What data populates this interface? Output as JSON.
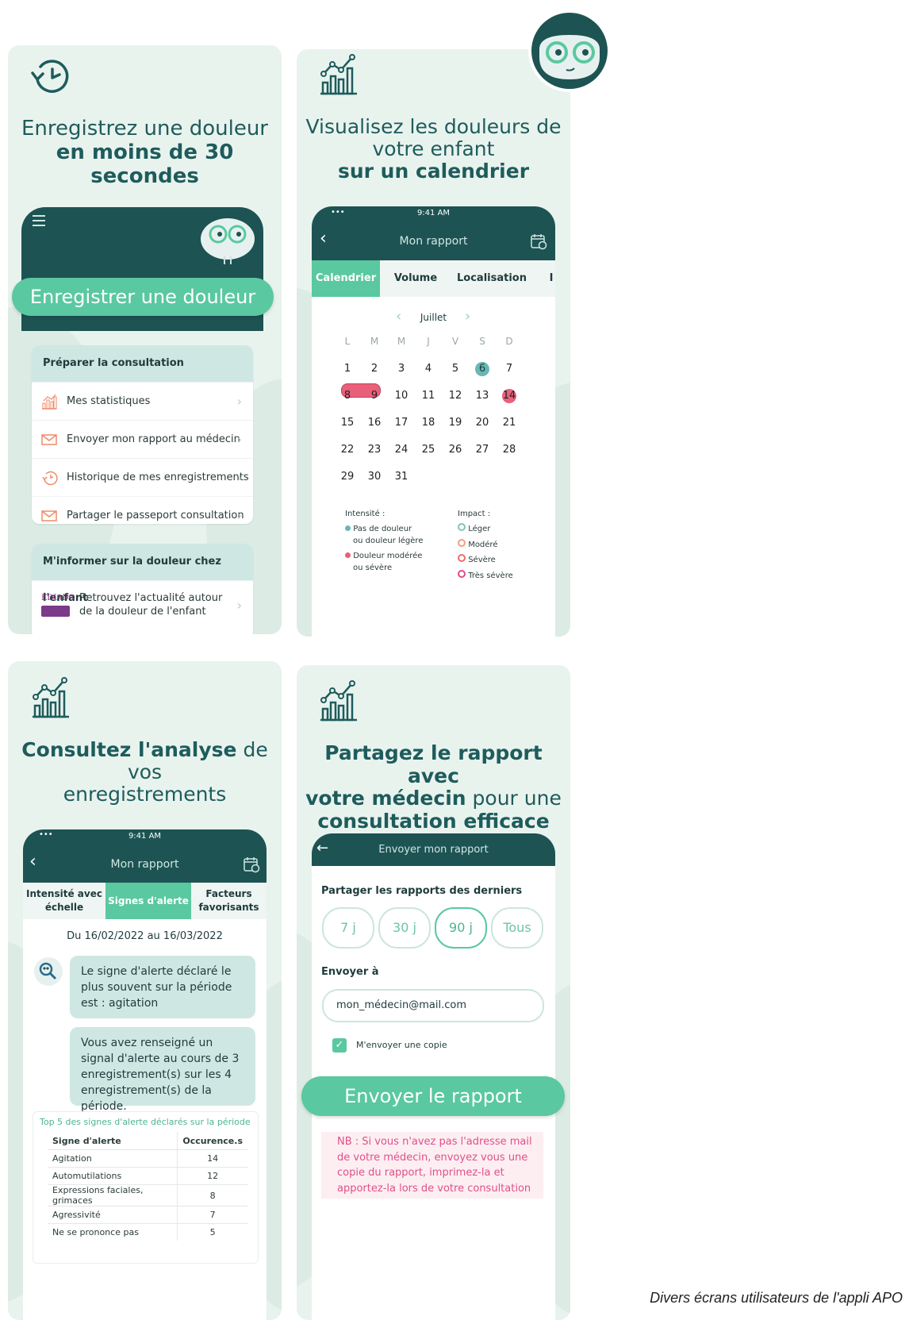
{
  "caption": "Divers écrans utilisateurs de l'appli APO",
  "colors": {
    "dark_teal": "#1d5353",
    "mint": "#5ac8a0",
    "light_panel": "#e9f3ee",
    "pain_red": "#e8607a",
    "teal_dot": "#6ab7b5"
  },
  "screen1": {
    "headline_line1": "Enregistrez une douleur",
    "headline_line2": "en moins de 30 secondes",
    "icon": "clock-check-icon",
    "register_button": "Enregistrer une douleur",
    "section1_title": "Préparer la consultation",
    "items": [
      {
        "label": "Mes statistiques",
        "icon": "bar-chart-icon"
      },
      {
        "label": "Envoyer mon rapport au médecin",
        "icon": "mail-icon"
      },
      {
        "label": "Historique de mes enregistrements",
        "icon": "history-icon"
      },
      {
        "label": "Partager le passeport consultation",
        "icon": "mail-icon"
      }
    ],
    "section2_title": "M'informer sur la douleur chez l'enfant",
    "pediadol_logo_text": "ÉDIADO",
    "news_line1": "Retrouvez l'actualité autour",
    "news_line2": "de la douleur de l'enfant"
  },
  "screen2": {
    "headline_line1": "Visualisez les douleurs de",
    "headline_line2": "votre enfant",
    "headline_line3": "sur un calendrier",
    "status_time": "9:41 AM",
    "title": "Mon rapport",
    "tabs": [
      "Calendrier",
      "Volume",
      "Localisation",
      "I"
    ],
    "month": "Juillet",
    "weekdays": [
      "L",
      "M",
      "M",
      "J",
      "V",
      "S",
      "D"
    ],
    "weeks": [
      [
        "1",
        "2",
        "3",
        "4",
        "5",
        "6",
        "7"
      ],
      [
        "8",
        "9",
        "10",
        "11",
        "12",
        "13",
        "14"
      ],
      [
        "15",
        "16",
        "17",
        "18",
        "19",
        "20",
        "21"
      ],
      [
        "22",
        "23",
        "24",
        "25",
        "26",
        "27",
        "28"
      ],
      [
        "29",
        "30",
        "31",
        "",
        "",
        "",
        ""
      ]
    ],
    "legend_intensity_title": "Intensité :",
    "legend_intensity_1a": "Pas de douleur",
    "legend_intensity_1b": "ou douleur légère",
    "legend_intensity_2a": "Douleur modérée",
    "legend_intensity_2b": "ou sévère",
    "legend_impact_title": "Impact :",
    "legend_impact": [
      "Léger",
      "Modéré",
      "Sévère",
      "Très sévère"
    ]
  },
  "screen3": {
    "headline_bold": "Consultez l'analyse",
    "headline_rest": " de vos",
    "headline_line2": "enregistrements",
    "status_time": "9:41 AM",
    "title": "Mon rapport",
    "tab1_line1": "Intensité avec",
    "tab1_line2": "échelle",
    "tab2": "Signes d'alerte",
    "tab3_line1": "Facteurs",
    "tab3_line2": "favorisants",
    "period": "Du 16/02/2022 au 16/03/2022",
    "bubble1": "Le signe d'alerte déclaré le plus souvent sur la période est : agitation",
    "bubble2": "Vous avez renseigné un signal d'alerte au cours de 3 enregistrement(s) sur les 4 enregistrement(s) de la période.",
    "top5_title": "Top 5 des signes d'alerte déclarés sur la période",
    "col_sign": "Signe d'alerte",
    "col_occ": "Occurence.s",
    "rows": [
      {
        "sign": "Agitation",
        "occ": "14"
      },
      {
        "sign": "Automutilations",
        "occ": "12"
      },
      {
        "sign": "Expressions faciales, grimaces",
        "occ": "8"
      },
      {
        "sign": "Agressivité",
        "occ": "7"
      },
      {
        "sign": "Ne se prononce pas",
        "occ": "5"
      }
    ]
  },
  "screen4": {
    "headline_line1_bold": "Partagez le rapport",
    "headline_line1_rest": " avec",
    "headline_line2_bold": "votre médecin",
    "headline_line2_rest": " pour une",
    "headline_line3": "consultation efficace",
    "title": "Envoyer mon rapport",
    "share_label": "Partager les rapports des derniers",
    "periods": [
      "7 j",
      "30 j",
      "90 j",
      "Tous"
    ],
    "selected_period": "90 j",
    "send_to_label": "Envoyer à",
    "email_value": "mon_médecin@mail.com",
    "copy_label": "M'envoyer une copie",
    "send_button": "Envoyer le rapport",
    "nb_text_1": "NB : Si vous n'avez pas l'adresse mail",
    "nb_text_2": "de votre médecin, envoyez vous une",
    "nb_text_3": "copie du rapport, imprimez-la et",
    "nb_text_4": "apportez-la lors de votre consultation"
  }
}
